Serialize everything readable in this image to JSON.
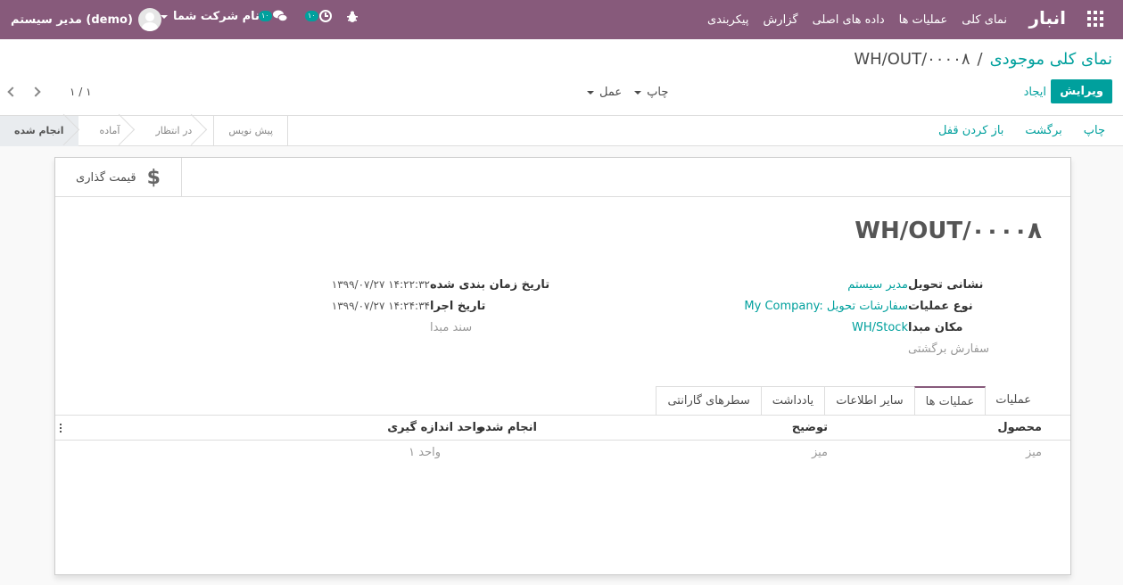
{
  "navbar": {
    "brand": "انبار",
    "menu": [
      "نمای کلی",
      "عملیات ها",
      "داده های اصلی",
      "گزارش",
      "پیکربندی"
    ],
    "user_name": "مدیر سیستم (demo)",
    "company": "نام شرکت شما",
    "messages_badge": "۱۰",
    "activities_badge": "۱۰"
  },
  "breadcrumb": {
    "parent": "نمای کلی موجودی",
    "separator": "/",
    "current": "WH/OUT/۰۰۰۰۸"
  },
  "buttons": {
    "edit": "ویرایش",
    "create": "ایجاد",
    "print": "چاپ",
    "action": "عمل"
  },
  "pager": {
    "text": "۱ / ۱"
  },
  "status_actions": [
    "چاپ",
    "برگشت",
    "باز کردن قفل"
  ],
  "stages": [
    "انجام شده",
    "آماده",
    "در انتظار",
    "پیش نویس"
  ],
  "smart_button": {
    "label": "قیمت گذاری",
    "icon": "dollar-icon"
  },
  "record": {
    "name": "WH/OUT/۰۰۰۰۸",
    "delivery_address_label": "نشانی تحویل",
    "delivery_address": "مدیر سیستم",
    "operation_type_label": "نوع عملیات",
    "operation_type": "My Company: سفارشات تحویل",
    "source_location_label": "مکان مبدا",
    "source_location": "WH/Stock",
    "return_order_label": "سفارش برگشتی",
    "scheduled_date_label": "تاریخ زمان بندی شده",
    "scheduled_date": "۱۳۹۹/۰۷/۲۷ ۱۴:۲۲:۳۲",
    "effective_date_label": "تاریخ اجرا",
    "effective_date": "۱۳۹۹/۰۷/۲۷ ۱۴:۲۴:۳۴",
    "source_document_label": "سند مبدا"
  },
  "tabs": [
    "عملیات",
    "عملیات ها",
    "سایر اطلاعات",
    "یادداشت",
    "سطرهای گارانتی"
  ],
  "table": {
    "headers": {
      "product": "محصول",
      "description": "توضیح",
      "done": "انجام شده",
      "uom": "واحد اندازه گیری"
    },
    "row": {
      "product": "میز",
      "description": "میز",
      "done": "۱ واحد"
    }
  },
  "colors": {
    "brand": "#875a7b",
    "accent": "#00a09d"
  }
}
